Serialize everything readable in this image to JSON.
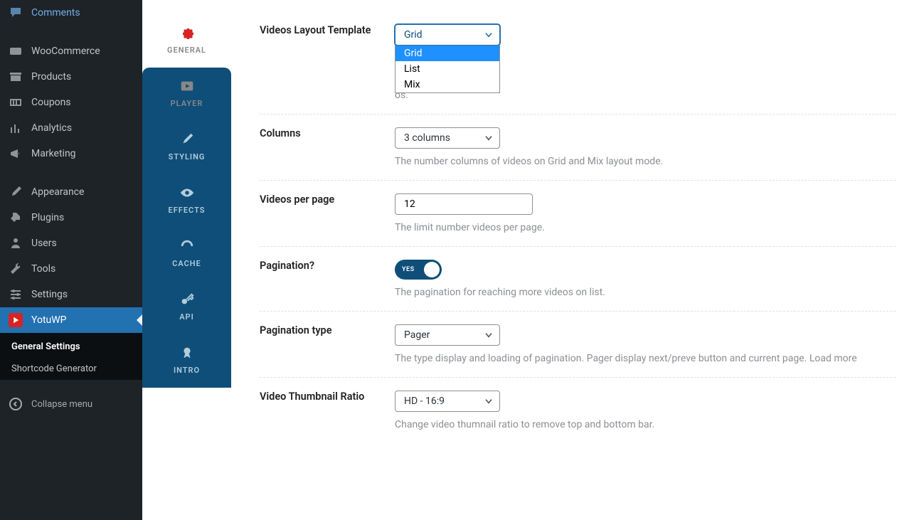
{
  "wp_menu": {
    "comments": "Comments",
    "woocommerce": "WooCommerce",
    "products": "Products",
    "coupons": "Coupons",
    "analytics": "Analytics",
    "marketing": "Marketing",
    "appearance": "Appearance",
    "plugins": "Plugins",
    "users": "Users",
    "tools": "Tools",
    "settings": "Settings",
    "yotuwp": "YotuWP",
    "sub_general": "General Settings",
    "sub_shortcode": "Shortcode Generator",
    "collapse": "Collapse menu"
  },
  "tabs": {
    "general": "GENERAL",
    "player": "PLAYER",
    "styling": "STYLING",
    "effects": "EFFECTS",
    "cache": "CACHE",
    "api": "API",
    "intro": "INTRO"
  },
  "settings": {
    "layout": {
      "label": "Videos Layout Template",
      "value": "Grid",
      "options": [
        "Grid",
        "List",
        "Mix"
      ],
      "desc_tail": "os."
    },
    "columns": {
      "label": "Columns",
      "value": "3 columns",
      "desc": "The number columns of videos on Grid and Mix layout mode."
    },
    "perpage": {
      "label": "Videos per page",
      "value": "12",
      "desc": "The limit number videos per page."
    },
    "pagination": {
      "label": "Pagination?",
      "state": "YES",
      "desc": "The pagination for reaching more videos on list."
    },
    "pagtype": {
      "label": "Pagination type",
      "value": "Pager",
      "desc": "The type display and loading of pagination. Pager display next/preve button and current page. Load more"
    },
    "thumbratio": {
      "label": "Video Thumbnail Ratio",
      "value": "HD - 16:9",
      "desc": "Change video thumnail ratio to remove top and bottom bar."
    }
  }
}
